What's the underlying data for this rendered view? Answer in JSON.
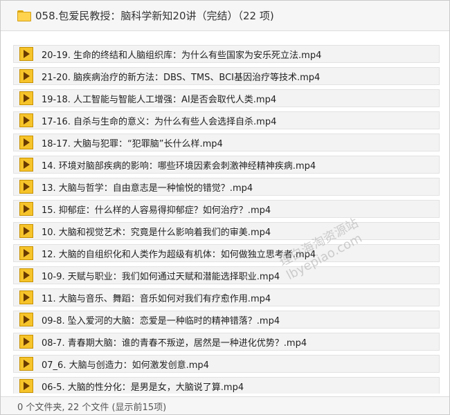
{
  "window": {
    "title": "058.包爱民教授：脑科学新知20讲（完结）（22 项)",
    "folder_icon": "folder-icon"
  },
  "files": [
    {
      "label": "20-19. 生命的终结和人脑组织库：为什么有些国家为安乐死立法.mp4",
      "icon": "media-file-icon"
    },
    {
      "label": "21-20. 脑疾病治疗的新方法：DBS、TMS、BCI基因治疗等技术.mp4",
      "icon": "media-file-icon"
    },
    {
      "label": "19-18. 人工智能与智能人工增强：AI是否会取代人类.mp4",
      "icon": "media-file-icon"
    },
    {
      "label": "17-16. 自杀与生命的意义：为什么有些人会选择自杀.mp4",
      "icon": "media-file-icon"
    },
    {
      "label": "18-17. 大脑与犯罪：“犯罪脑”长什么样.mp4",
      "icon": "media-file-icon"
    },
    {
      "label": "14. 环境对脑部疾病的影响：哪些环境因素会刺激神经精神疾病.mp4",
      "icon": "media-file-icon"
    },
    {
      "label": "13. 大脑与哲学：自由意志是一种愉悦的错觉？.mp4",
      "icon": "media-file-icon"
    },
    {
      "label": "15. 抑郁症：什么样的人容易得抑郁症？如何治疗？.mp4",
      "icon": "media-file-icon"
    },
    {
      "label": "10. 大脑和视觉艺术：究竟是什么影响着我们的审美.mp4",
      "icon": "media-file-icon"
    },
    {
      "label": "12. 大脑的自组织化和人类作为超级有机体：如何做独立思考者.mp4",
      "icon": "media-file-icon"
    },
    {
      "label": "10-9. 天赋与职业：我们如何通过天赋和潜能选择职业.mp4",
      "icon": "media-file-icon"
    },
    {
      "label": "11. 大脑与音乐、舞蹈：音乐如何对我们有疗愈作用.mp4",
      "icon": "media-file-icon"
    },
    {
      "label": "09-8. 坠入爱河的大脑：恋爱是一种临时的精神错落？.mp4",
      "icon": "media-file-icon"
    },
    {
      "label": "08-7. 青春期大脑：谁的青春不叛逆，居然是一种进化优势？.mp4",
      "icon": "media-file-icon"
    },
    {
      "label": "07_6. 大脑与创造力：如何激发创意.mp4",
      "icon": "media-file-icon"
    },
    {
      "label": "06-5. 大脑的性分化：是男是女，大脑说了算.mp4",
      "icon": "media-file-icon"
    }
  ],
  "watermark": {
    "line1": "理白海淘资源站",
    "line2": "lbyepiao.com"
  },
  "status": {
    "text": "0 个文件夹, 22 个文件 (显示前15项)"
  }
}
